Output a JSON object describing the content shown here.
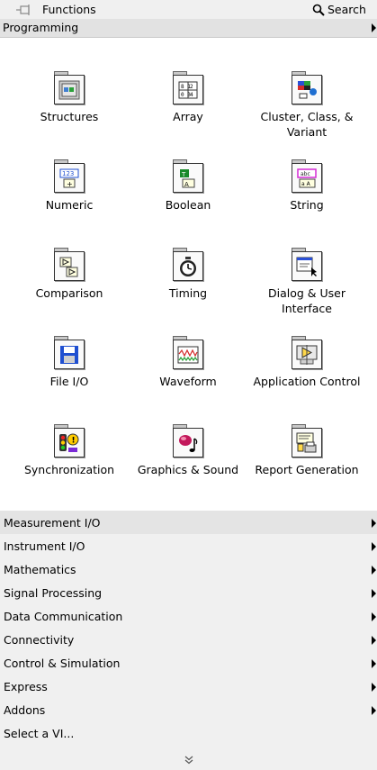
{
  "header": {
    "title": "Functions",
    "search_label": "Search"
  },
  "palette": {
    "name": "Programming",
    "items": [
      {
        "label": "Structures",
        "icon": "structures-icon"
      },
      {
        "label": "Array",
        "icon": "array-icon"
      },
      {
        "label": "Cluster, Class, & Variant",
        "icon": "cluster-class-variant-icon"
      },
      {
        "label": "Numeric",
        "icon": "numeric-icon"
      },
      {
        "label": "Boolean",
        "icon": "boolean-icon"
      },
      {
        "label": "String",
        "icon": "string-icon"
      },
      {
        "label": "Comparison",
        "icon": "comparison-icon"
      },
      {
        "label": "Timing",
        "icon": "timing-icon"
      },
      {
        "label": "Dialog & User Interface",
        "icon": "dialog-user-interface-icon"
      },
      {
        "label": "File I/O",
        "icon": "file-io-icon"
      },
      {
        "label": "Waveform",
        "icon": "waveform-icon"
      },
      {
        "label": "Application Control",
        "icon": "application-control-icon"
      },
      {
        "label": "Synchronization",
        "icon": "synchronization-icon"
      },
      {
        "label": "Graphics & Sound",
        "icon": "graphics-sound-icon"
      },
      {
        "label": "Report Generation",
        "icon": "report-generation-icon"
      }
    ]
  },
  "categories": [
    "Measurement I/O",
    "Instrument I/O",
    "Mathematics",
    "Signal Processing",
    "Data Communication",
    "Connectivity",
    "Control & Simulation",
    "Express",
    "Addons"
  ],
  "select_vi": "Select a VI..."
}
